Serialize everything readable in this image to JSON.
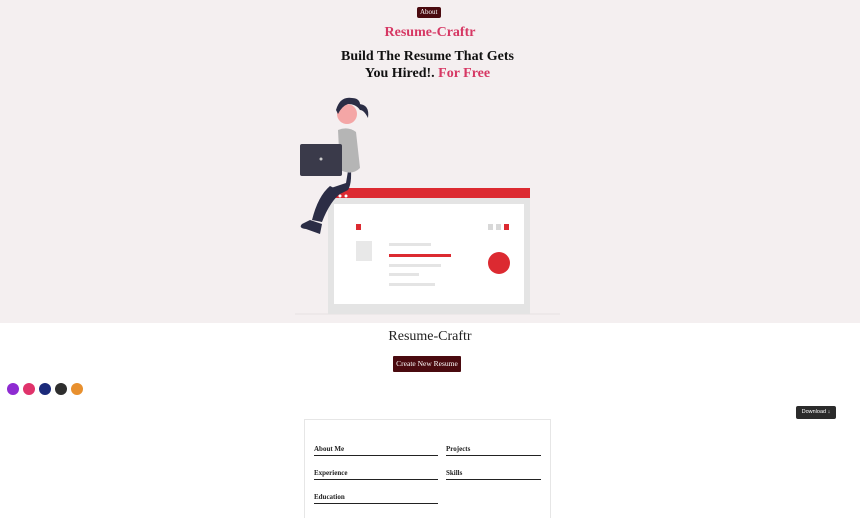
{
  "nav": {
    "about_label": "About"
  },
  "hero": {
    "brand": "Resume-Craftr",
    "headline_main": "Build The Resume That Gets You Hired!.",
    "headline_accent": "For Free"
  },
  "builder": {
    "title": "Resume-Craftr",
    "create_button": "Create New Resume",
    "download_button": "Download",
    "download_icon": "↓",
    "color_options": [
      "#8e2bd1",
      "#e0336b",
      "#1b2a7a",
      "#2e2e2e",
      "#e8902e"
    ]
  },
  "sections": {
    "about_me": "About Me",
    "experience": "Experience",
    "education": "Education",
    "projects": "Projects",
    "skills": "Skills"
  }
}
